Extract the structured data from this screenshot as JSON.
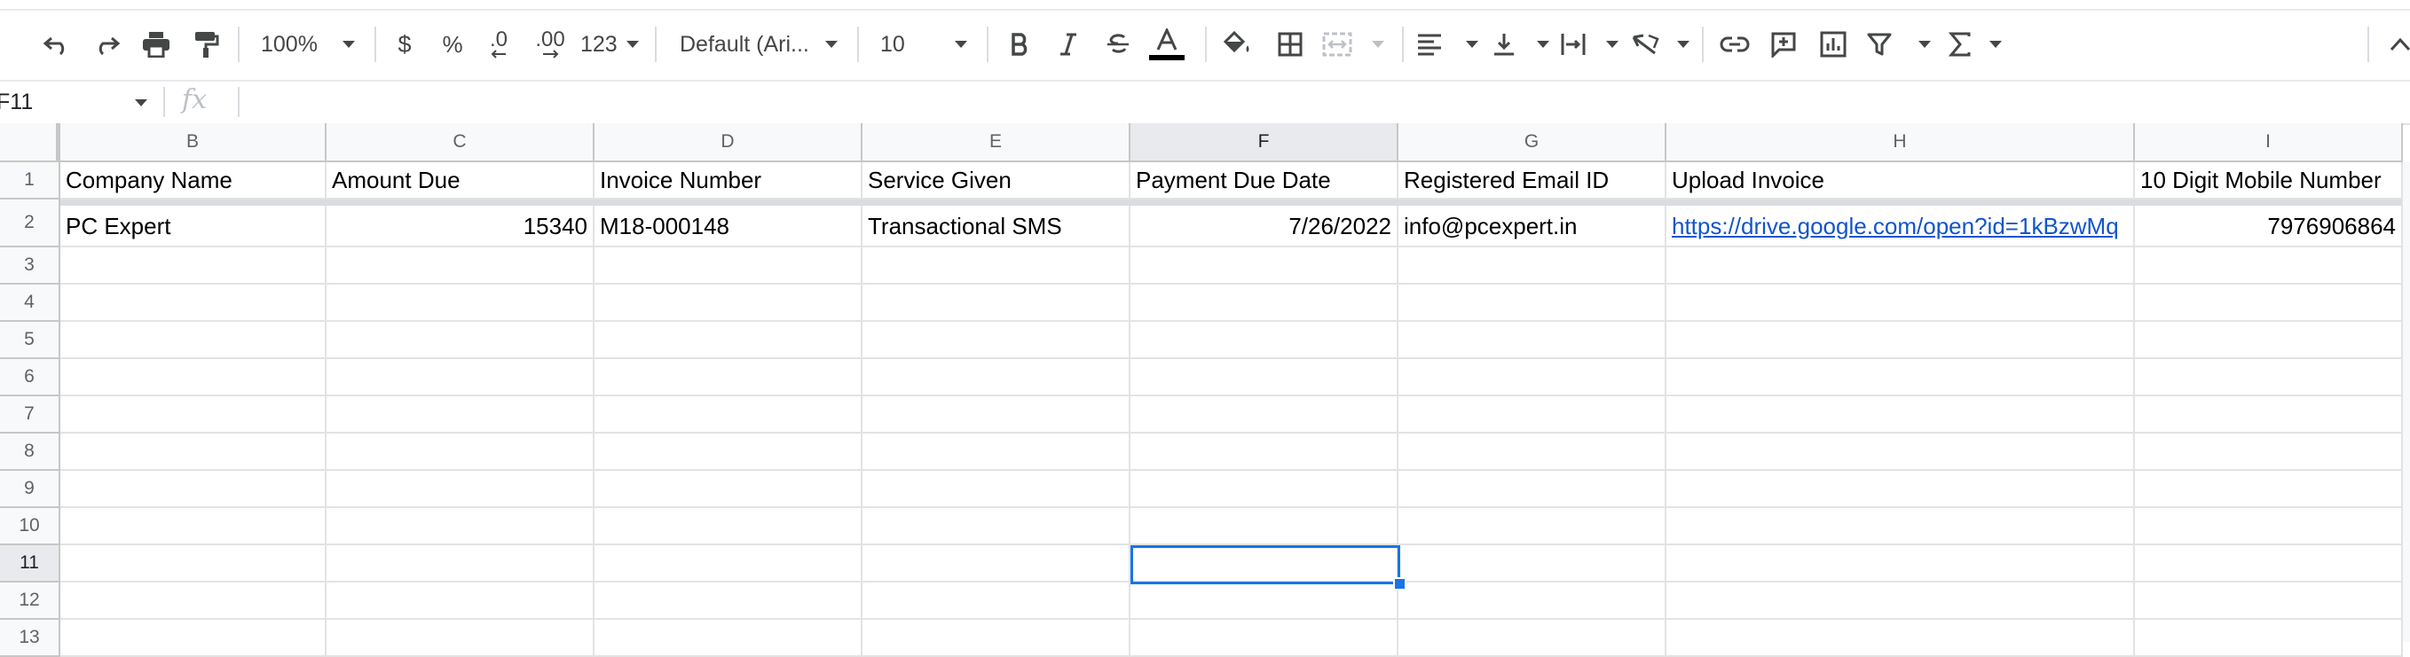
{
  "toolbar": {
    "zoom": "100%",
    "currency": "$",
    "percent": "%",
    "decimal_decrease": ".0",
    "decimal_increase": ".00",
    "number_format": "123",
    "font_family": "Default (Ari...",
    "font_size": "10",
    "text_color_underline": "#000000",
    "icons": [
      "undo-icon",
      "redo-icon",
      "print-icon",
      "paint-format-icon",
      "bold-icon",
      "italic-icon",
      "strikethrough-icon",
      "text-color-icon",
      "fill-color-icon",
      "borders-icon",
      "merge-cells-icon",
      "horizontal-align-icon",
      "vertical-align-icon",
      "text-wrapping-icon",
      "text-rotation-icon",
      "link-icon",
      "comment-icon",
      "chart-icon",
      "filter-icon",
      "functions-icon"
    ]
  },
  "formula_bar": {
    "name_box": "F11",
    "fx_label": "fx",
    "value": ""
  },
  "columns": [
    "B",
    "C",
    "D",
    "E",
    "F",
    "G",
    "H",
    "I"
  ],
  "selected_column": "F",
  "rows": [
    "1",
    "2",
    "3",
    "4",
    "5",
    "6",
    "7",
    "8",
    "9",
    "10",
    "11",
    "12",
    "13"
  ],
  "selected_row": "11",
  "header_row": [
    "Company Name",
    "Amount Due",
    "Invoice Number",
    "Service Given",
    "Payment Due Date",
    "Registered Email ID",
    "Upload Invoice",
    "10 Digit Mobile Number"
  ],
  "data_row": [
    "PC Expert",
    "15340",
    "M18-000148",
    "Transactional SMS",
    "7/26/2022",
    "info@pcexpert.in",
    "https://drive.google.com/open?id=1kBzwMq",
    "7976906864"
  ],
  "colors": {
    "selection": "#1a73e8",
    "link": "#1155cc",
    "header_bg": "#f8f9fa"
  }
}
